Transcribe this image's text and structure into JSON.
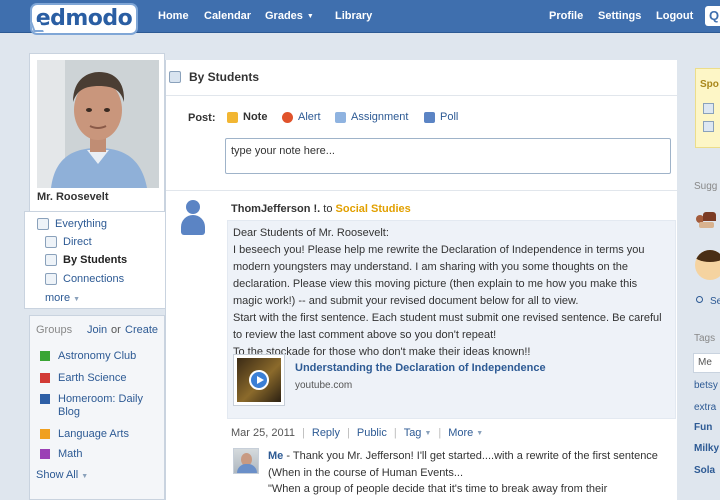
{
  "header": {
    "logo": "edmodo",
    "nav_left": [
      {
        "label": "Home"
      },
      {
        "label": "Calendar"
      },
      {
        "label": "Grades"
      },
      {
        "label": "Library"
      }
    ],
    "nav_right": [
      {
        "label": "Profile"
      },
      {
        "label": "Settings"
      },
      {
        "label": "Logout"
      }
    ]
  },
  "profile": {
    "name": "Mr. Roosevelt"
  },
  "leftnav": {
    "items": [
      {
        "label": "Everything",
        "icon": "everything-icon"
      },
      {
        "label": "Direct",
        "icon": "direct-icon"
      },
      {
        "label": "By Students",
        "icon": "students-icon"
      },
      {
        "label": "Connections",
        "icon": "connections-icon"
      }
    ],
    "more": "more"
  },
  "groups": {
    "heading": "Groups",
    "join": "Join",
    "or": "or",
    "create": "Create",
    "items": [
      {
        "label": "Astronomy Club",
        "color": "#3aa535"
      },
      {
        "label": "Earth Science",
        "color": "#d23b36"
      },
      {
        "label": "Homeroom: Daily Blog",
        "color": "#2d5fa6"
      },
      {
        "label": "Language Arts",
        "color": "#f0a020"
      },
      {
        "label": "Math",
        "color": "#9b40b5"
      }
    ],
    "show_all": "Show All"
  },
  "main": {
    "title": "By Students",
    "post_label": "Post:",
    "post_options": [
      {
        "label": "Note",
        "icon": "note-icon",
        "color": "#f2b632"
      },
      {
        "label": "Alert",
        "icon": "alert-icon",
        "color": "#e0532b"
      },
      {
        "label": "Assignment",
        "icon": "assignment-icon",
        "color": "#8fb3e0"
      },
      {
        "label": "Poll",
        "icon": "poll-icon",
        "color": "#5b84c4"
      }
    ],
    "note_value": "type your note here..."
  },
  "post": {
    "author": "ThomJefferson !.",
    "to": "to",
    "group": "Social Studies",
    "lines": [
      "Dear Students of Mr. Roosevelt:",
      "I beseech you! Please help me rewrite the Declaration of Independence in terms you",
      "modern youngsters may understand. I am sharing with you some thoughts on the",
      "declaration. Please view this moving picture (then explain to me how you make this",
      "magic work!) -- and submit your revised document below for all to view.",
      "Start with the first sentence. Each student must submit one revised sentence. Be careful",
      "to review the last comment above so you don't repeat!",
      "To the stockade for those who don't make their ideas known!!"
    ],
    "video_title": "Understanding the Declaration of Independence",
    "video_source": "youtube.com",
    "date": "Mar 25, 2011",
    "actions": {
      "reply": "Reply",
      "public": "Public",
      "tag": "Tag",
      "more": "More"
    }
  },
  "reply": {
    "author": "Me",
    "lines": [
      "- Thank you Mr. Jefferson! I'll get started....with a rewrite of the first sentence",
      "(When in the course of Human Events...",
      "\"When a group of people decide that it's time to break away from their"
    ]
  },
  "right": {
    "spotlight": "Spo",
    "suggested": "Sugg",
    "search": "Se",
    "tags_head": "Tags",
    "tag_input": "Me",
    "tags": [
      "betsy",
      "extra",
      "Fun",
      "Milky",
      "Sola"
    ]
  }
}
